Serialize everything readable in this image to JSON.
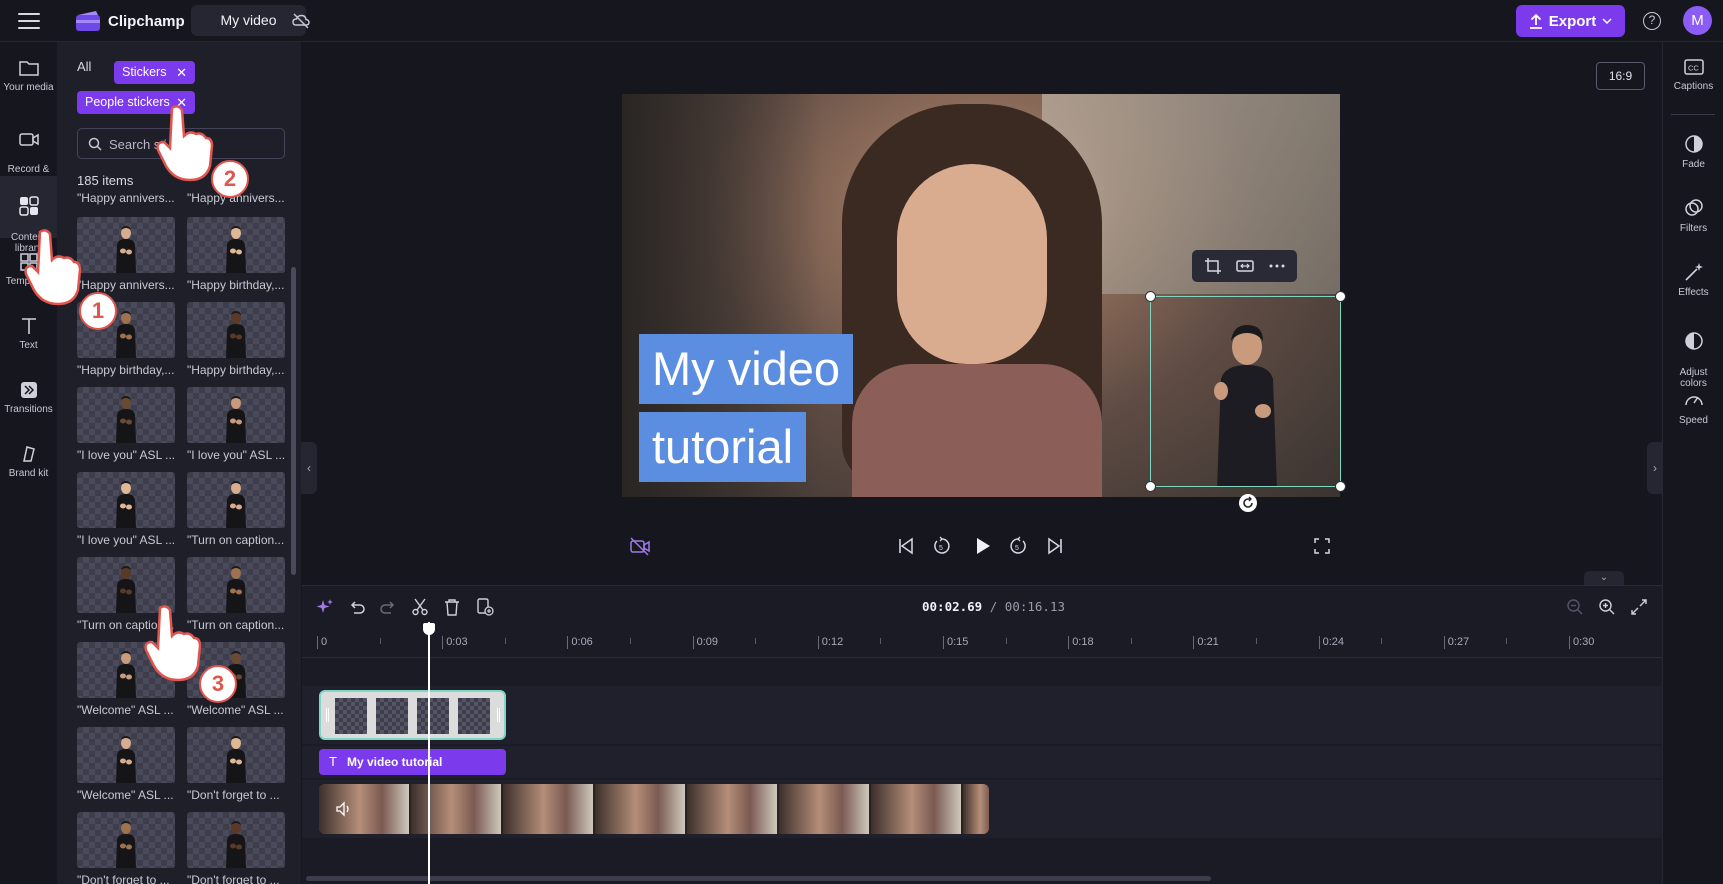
{
  "app": {
    "name": "Clipchamp",
    "project_title": "My video"
  },
  "topbar": {
    "export_label": "Export",
    "help_label": "?",
    "avatar_initial": "M"
  },
  "left_rail": [
    {
      "id": "your-media",
      "label": "Your media"
    },
    {
      "id": "record-create",
      "label": "Record &\ncreate"
    },
    {
      "id": "content-library",
      "label": "Content\nlibrary"
    },
    {
      "id": "templates",
      "label": "Templates"
    },
    {
      "id": "text",
      "label": "Text"
    },
    {
      "id": "transitions",
      "label": "Transitions"
    },
    {
      "id": "brand-kit",
      "label": "Brand kit"
    }
  ],
  "library": {
    "filter_all": "All",
    "chip_stickers": "Stickers",
    "chip_people": "People stickers",
    "chip_close": "✕",
    "search_placeholder": "Search sti",
    "count": "185 items",
    "top_captions": [
      "\"Happy annivers...",
      "\"Happy annivers..."
    ],
    "items": [
      "\"Happy annivers...",
      "\"Happy birthday,...",
      "\"Happy birthday,...",
      "\"Happy birthday,...",
      "\"I love you\" ASL ...",
      "\"I love you\" ASL ...",
      "\"I love you\" ASL ...",
      "\"Turn on caption...",
      "\"Turn on caption...",
      "\"Turn on caption...",
      "\"Welcome\" ASL ...",
      "\"Welcome\" ASL ...",
      "\"Welcome\" ASL ...",
      "\"Don't forget to ...",
      "\"Don't forget to ...",
      "\"Don't forget to ..."
    ]
  },
  "preview": {
    "aspect_ratio": "16:9",
    "caption_line1": "My video",
    "caption_line2": "tutorial"
  },
  "right_rail": [
    {
      "id": "captions",
      "label": "Captions"
    },
    {
      "id": "fade",
      "label": "Fade"
    },
    {
      "id": "filters",
      "label": "Filters"
    },
    {
      "id": "effects",
      "label": "Effects"
    },
    {
      "id": "adjust-colors",
      "label": "Adjust\ncolors"
    },
    {
      "id": "speed",
      "label": "Speed"
    }
  ],
  "timeline": {
    "current_time": "00:02.69",
    "separator": " / ",
    "total_time": "00:16.13",
    "ruler_labels": [
      "0",
      "0:03",
      "0:06",
      "0:09",
      "0:12",
      "0:15",
      "0:18",
      "0:21",
      "0:24",
      "0:27",
      "0:30"
    ],
    "text_clip_label": "My video tutorial",
    "text_clip_icon": "T"
  },
  "tutorial_steps": [
    "1",
    "2",
    "3"
  ],
  "colors": {
    "accent": "#7c3aed",
    "caption_bg": "#5b8de0",
    "selection": "#7fd6c3",
    "step_badge": "#e0564e"
  }
}
